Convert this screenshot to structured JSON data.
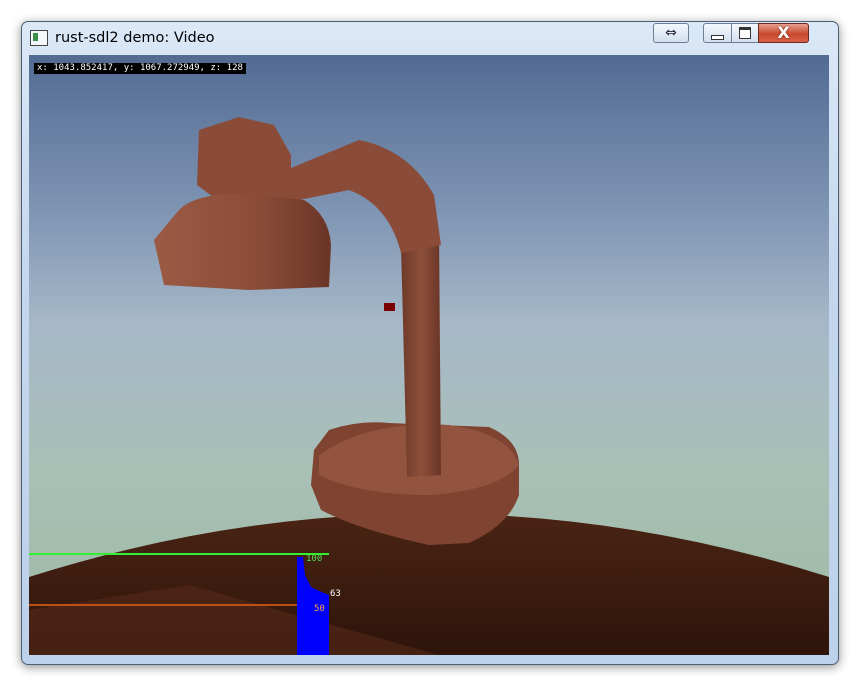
{
  "window": {
    "title": "rust-sdl2 demo: Video",
    "controls": {
      "restore_alt_glyph": "⇔",
      "minimize_glyph": "▁",
      "maximize_glyph": "▢",
      "close_glyph": "X"
    }
  },
  "overlay": {
    "coords_text": "x: 1043.852417, y: 1067.272949, z: 128"
  },
  "frame_graph": {
    "label_max": "100",
    "label_current": "63",
    "label_mid": "50",
    "max_value": 100,
    "mid_value": 50,
    "current_value": 63,
    "colors": {
      "max_line": "#33ee33",
      "mid_line": "#e8601c",
      "bars": "#0000ff"
    }
  },
  "colors": {
    "sky_top": "#526b93",
    "horizon": "#9cbaa2",
    "table": "#3a1b10",
    "lamp": "#8a4c39"
  }
}
